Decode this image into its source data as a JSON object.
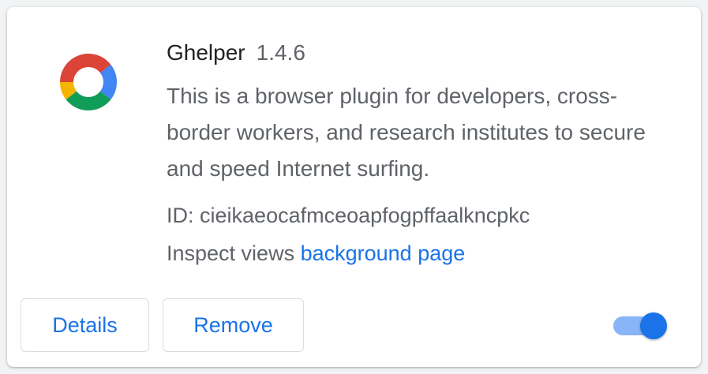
{
  "extension": {
    "icon": "ghelper-ring-icon",
    "name": "Ghelper",
    "version": "1.4.6",
    "description": "This is a browser plugin for developers, cross-border workers, and research institutes to secure and speed Internet surfing.",
    "id_label": "ID:",
    "id_value": "cieikaeocafmceoapfogpffaalkncpkc",
    "inspect_label": "Inspect views",
    "inspect_link": "background page",
    "enabled": true
  },
  "actions": {
    "details_label": "Details",
    "remove_label": "Remove"
  },
  "colors": {
    "accent": "#1a73e8",
    "toggle_track": "#8ab4f8",
    "ring_red": "#db4437",
    "ring_blue": "#4285f4",
    "ring_green": "#0f9d58",
    "ring_yellow": "#f4b400"
  }
}
